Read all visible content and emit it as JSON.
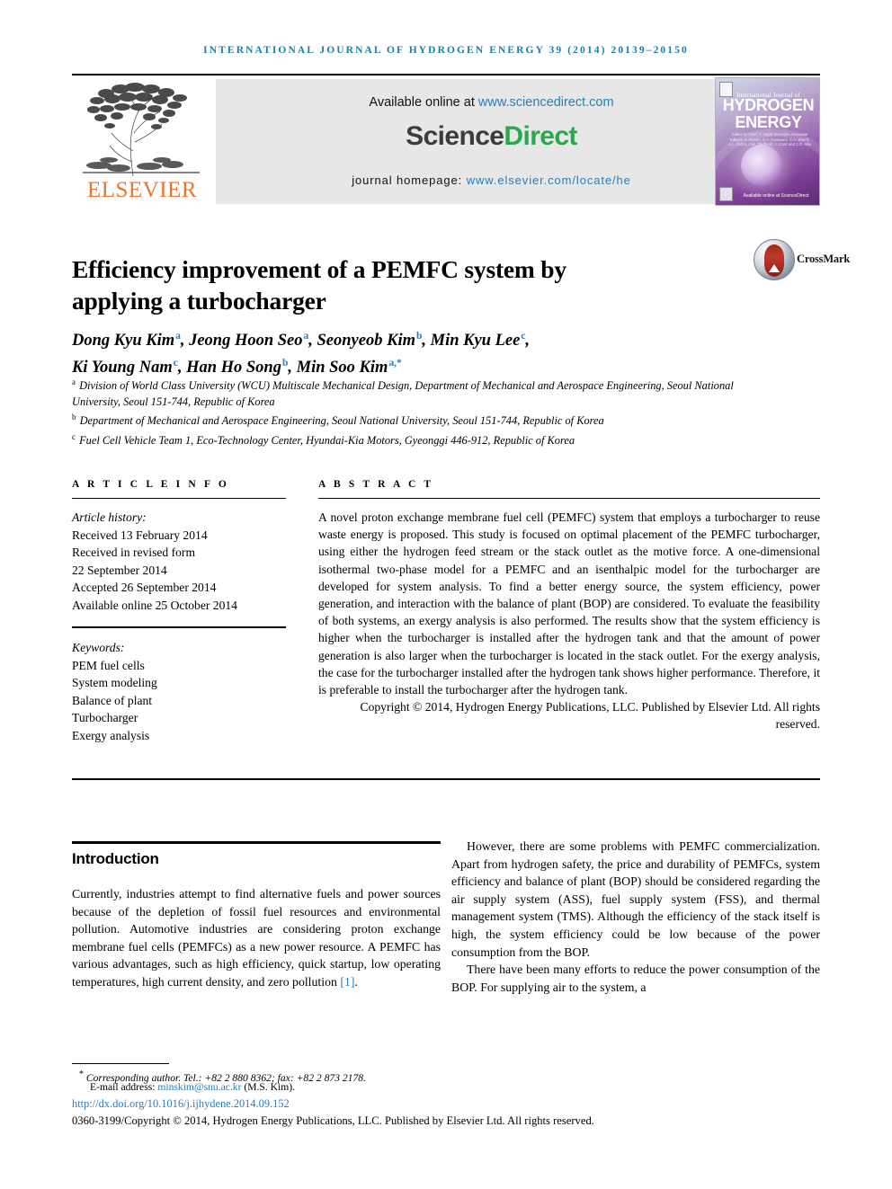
{
  "running_head": "International Journal of Hydrogen Energy 39 (2014) 20139–20150",
  "banner": {
    "publisher_name": "ELSEVIER",
    "available_prefix": "Available online at ",
    "sciencedirect_url": "www.sciencedirect.com",
    "sciencedirect_logo_part1": "Science",
    "sciencedirect_logo_part2": "Direct",
    "homepage_label": "journal homepage: ",
    "homepage_url": "www.elsevier.com/locate/he",
    "cover": {
      "line_small": "International Journal of",
      "line_big_1": "HYDROGEN",
      "line_big_2": "ENERGY",
      "editors": "Editor-in-Chief: T. Nejat Veziroğlu\nAssociate Editors: A. Rosen, D.Y. Goswami, S.A. Sherif,\nA.L. Dicks, J.W. Sheffield,\nJ. Cunt and J.O. Abe",
      "sciencedirect_footer": "Available online at ScienceDirect"
    }
  },
  "article": {
    "title": "Efficiency improvement of a PEMFC system by applying a turbocharger",
    "crossmark_label": "CrossMark",
    "authors_line_1": [
      {
        "name": "Dong Kyu Kim",
        "sup": "a"
      },
      {
        "name": "Jeong Hoon Seo",
        "sup": "a"
      },
      {
        "name": "Seonyeob Kim",
        "sup": "b"
      },
      {
        "name": "Min Kyu Lee",
        "sup": "c"
      }
    ],
    "authors_line_2": [
      {
        "name": "Ki Young Nam",
        "sup": "c"
      },
      {
        "name": "Han Ho Song",
        "sup": "b"
      },
      {
        "name": "Min Soo Kim",
        "sup": "a,*"
      }
    ],
    "affiliations": [
      {
        "marker": "a",
        "text": "Division of World Class University (WCU) Multiscale Mechanical Design, Department of Mechanical and Aerospace Engineering, Seoul National University, Seoul 151-744, Republic of Korea"
      },
      {
        "marker": "b",
        "text": "Department of Mechanical and Aerospace Engineering, Seoul National University, Seoul 151-744, Republic of Korea"
      },
      {
        "marker": "c",
        "text": "Fuel Cell Vehicle Team 1, Eco-Technology Center, Hyundai-Kia Motors, Gyeonggi 446-912, Republic of Korea"
      }
    ]
  },
  "article_info": {
    "heading": "A R T I C L E    I N F O",
    "history_label": "Article history:",
    "history": [
      "Received 13 February 2014",
      "Received in revised form",
      "22 September 2014",
      "Accepted 26 September 2014",
      "Available online 25 October 2014"
    ],
    "keywords_label": "Keywords:",
    "keywords": [
      "PEM fuel cells",
      "System modeling",
      "Balance of plant",
      "Turbocharger",
      "Exergy analysis"
    ]
  },
  "abstract": {
    "heading": "A B S T R A C T",
    "text": "A novel proton exchange membrane fuel cell (PEMFC) system that employs a turbocharger to reuse waste energy is proposed. This study is focused on optimal placement of the PEMFC turbocharger, using either the hydrogen feed stream or the stack outlet as the motive force. A one-dimensional isothermal two-phase model for a PEMFC and an isenthalpic model for the turbocharger are developed for system analysis. To find a better energy source, the system efficiency, power generation, and interaction with the balance of plant (BOP) are considered. To evaluate the feasibility of both systems, an exergy analysis is also performed. The results show that the system efficiency is higher when the turbocharger is installed after the hydrogen tank and that the amount of power generation is also larger when the turbocharger is located in the stack outlet. For the exergy analysis, the case for the turbocharger installed after the hydrogen tank shows higher performance. Therefore, it is preferable to install the turbocharger after the hydrogen tank.",
    "copyright": "Copyright © 2014, Hydrogen Energy Publications, LLC. Published by Elsevier Ltd. All rights reserved."
  },
  "body": {
    "intro_heading": "Introduction",
    "left_paragraph_1_a": "Currently, industries attempt to find alternative fuels and power sources because of the depletion of fossil fuel resources and environmental pollution. Automotive industries are considering proton exchange membrane fuel cells (PEMFCs) as a new power resource. A PEMFC has various advantages, such as high efficiency, quick startup, low operating temperatures, high current density, and zero pollution ",
    "left_paragraph_1_ref": "[1]",
    "left_paragraph_1_b": ".",
    "right_paragraph_1": "However, there are some problems with PEMFC commercialization. Apart from hydrogen safety, the price and durability of PEMFCs, system efficiency and balance of plant (BOP) should be considered regarding the air supply system (ASS), fuel supply system (FSS), and thermal management system (TMS). Although the efficiency of the stack itself is high, the system efficiency could be low because of the power consumption from the BOP.",
    "right_paragraph_2": "There have been many efforts to reduce the power consumption of the BOP. For supplying air to the system, a"
  },
  "footer": {
    "corresponding_star": "*",
    "corresponding_text": " Corresponding author. Tel.: +82 2 880 8362; fax: +82 2 873 2178.",
    "email_label": "E-mail address: ",
    "email_address": "minskim@snu.ac.kr",
    "email_suffix": " (M.S. Kim).",
    "doi": "http://dx.doi.org/10.1016/j.ijhydene.2014.09.152",
    "issn_line": "0360-3199/Copyright © 2014, Hydrogen Energy Publications, LLC. Published by Elsevier Ltd. All rights reserved."
  },
  "colors": {
    "link": "#2b7db5",
    "running_head": "#1a7fa8",
    "elsevier_orange": "#e8762c",
    "sciencedirect_green": "#2aa84a"
  }
}
